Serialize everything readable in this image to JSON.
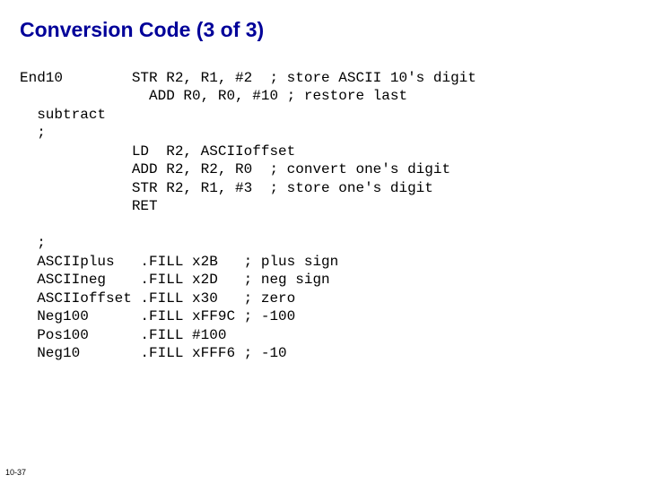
{
  "title": "Conversion Code (3 of 3)",
  "code": {
    "l0": "End10        STR R2, R1, #2  ; store ASCII 10's digit",
    "l1": "               ADD R0, R0, #10 ; restore last",
    "l2": "  subtract",
    "l3": "  ;",
    "l4": "             LD  R2, ASCIIoffset",
    "l5": "             ADD R2, R2, R0  ; convert one's digit",
    "l6": "             STR R2, R1, #3  ; store one's digit",
    "l7": "             RET",
    "l8": "",
    "l9": "  ;",
    "l10": "  ASCIIplus   .FILL x2B   ; plus sign",
    "l11": "  ASCIIneg    .FILL x2D   ; neg sign",
    "l12": "  ASCIIoffset .FILL x30   ; zero",
    "l13": "  Neg100      .FILL xFF9C ; -100",
    "l14": "  Pos100      .FILL #100",
    "l15": "  Neg10       .FILL xFFF6 ; -10"
  },
  "slidenum": "10-37"
}
